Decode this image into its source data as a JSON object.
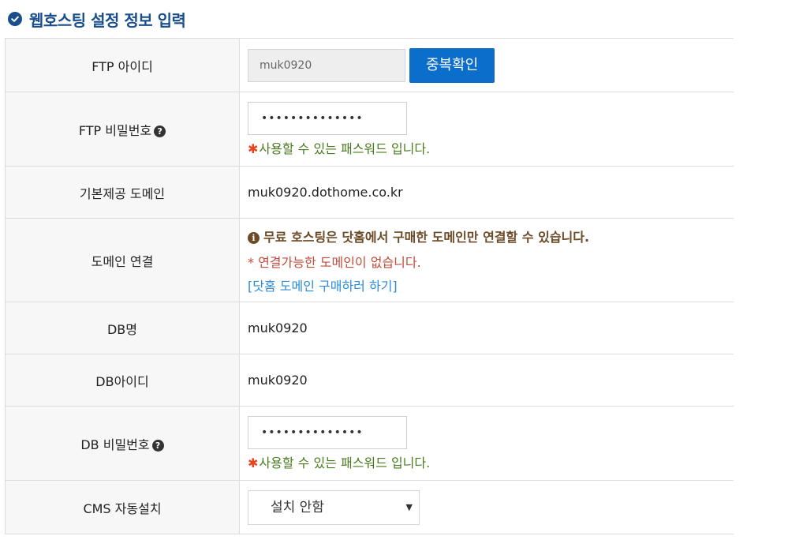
{
  "section": {
    "title": "웹호스팅 설정 정보 입력"
  },
  "form": {
    "ftp_id": {
      "label": "FTP 아이디",
      "value": "muk0920",
      "button": "중복확인"
    },
    "ftp_pw": {
      "label": "FTP 비밀번호",
      "value": "••••••••••••••",
      "star": "✱",
      "message": "사용할 수 있는 패스워드 입니다."
    },
    "domain": {
      "label": "기본제공 도메인",
      "value": "muk0920.dothome.co.kr"
    },
    "domain_link": {
      "label": "도메인 연결",
      "notice": "무료 호스팅은 닷홈에서 구매한 도메인만 연결할 수 있습니다.",
      "warning": "* 연결가능한 도메인이 없습니다.",
      "link": "[닷홈 도메인 구매하러 하기]"
    },
    "db_name": {
      "label": "DB명",
      "value": "muk0920"
    },
    "db_id": {
      "label": "DB아이디",
      "value": "muk0920"
    },
    "db_pw": {
      "label": "DB 비밀번호",
      "value": "••••••••••••••",
      "star": "✱",
      "message": "사용할 수 있는 패스워드 입니다."
    },
    "cms": {
      "label": "CMS 자동설치",
      "selected": "설치 안함"
    }
  },
  "icons": {
    "title_icon": "check-circle-icon",
    "help_icon": "question-circle-icon",
    "info_icon": "info-circle-icon",
    "select_arrow": "caret-down-icon"
  },
  "colors": {
    "title": "#1a4f8c",
    "button": "#0c6ecb",
    "success": "#4a7a1e",
    "warning": "#c24b3a",
    "notice": "#6b4a25",
    "link": "#2b8cdd",
    "asterisk": "#e8441e"
  }
}
